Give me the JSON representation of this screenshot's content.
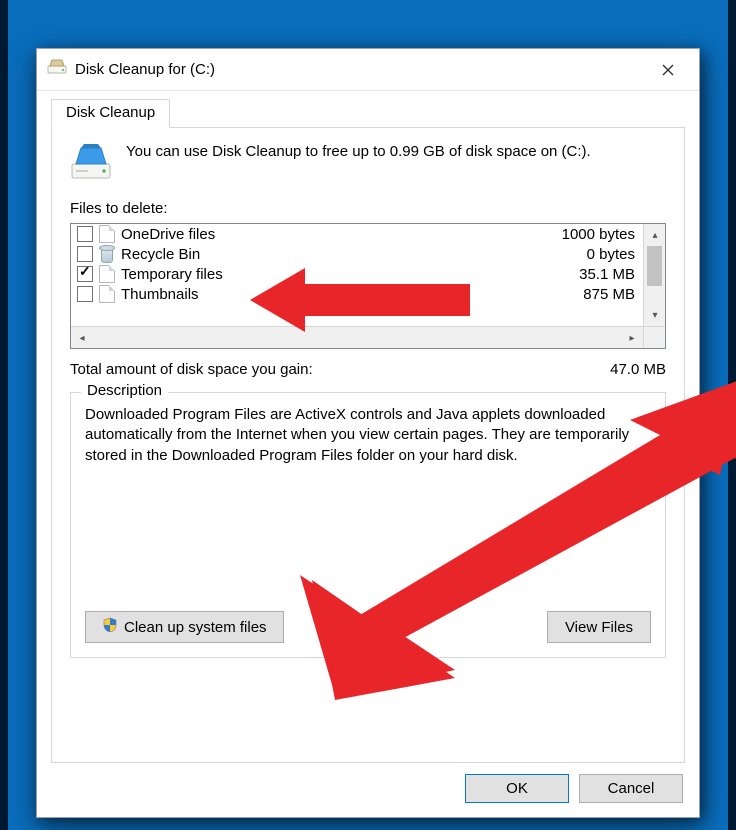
{
  "window": {
    "title": "Disk Cleanup for  (C:)"
  },
  "tab_label": "Disk Cleanup",
  "intro": "You can use Disk Cleanup to free up to 0.99 GB of disk space on  (C:).",
  "files_label": "Files to delete:",
  "items": [
    {
      "label": "OneDrive files",
      "size": "1000 bytes",
      "checked": false,
      "icon": "page"
    },
    {
      "label": "Recycle Bin",
      "size": "0 bytes",
      "checked": false,
      "icon": "bin"
    },
    {
      "label": "Temporary files",
      "size": "35.1 MB",
      "checked": true,
      "icon": "page"
    },
    {
      "label": "Thumbnails",
      "size": "875 MB",
      "checked": false,
      "icon": "page"
    }
  ],
  "total": {
    "label": "Total amount of disk space you gain:",
    "value": "47.0 MB"
  },
  "description": {
    "legend": "Description",
    "text": "Downloaded Program Files are ActiveX controls and Java applets downloaded automatically from the Internet when you view certain pages. They are temporarily stored in the Downloaded Program Files folder on your hard disk."
  },
  "buttons": {
    "clean_system": "Clean up system files",
    "view_files": "View Files",
    "ok": "OK",
    "cancel": "Cancel"
  },
  "colors": {
    "arrow": "#e8262a"
  }
}
